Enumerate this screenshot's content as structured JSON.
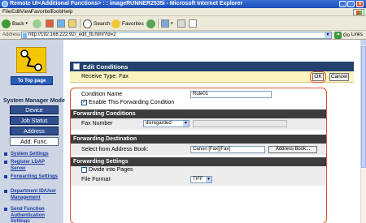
{
  "window": {
    "title": "Remote UI<Additional Functions> : : imageRUNNER2535i - Microsoft Internet Explorer"
  },
  "menu": {
    "items": [
      "File",
      "Edit",
      "View",
      "Favorites",
      "Tools",
      "Help"
    ]
  },
  "toolbar": {
    "back": "Back",
    "search": "Search",
    "favorites": "Favorites"
  },
  "address": {
    "label": "Address",
    "url": "http://192.168.222.92/_edit_fb.html?id=2",
    "go": "Go",
    "links": "Links"
  },
  "sidebar": {
    "top_page": "To Top page",
    "mode_title": "System Manager Mode",
    "nav": [
      "Device",
      "Job Status",
      "Address",
      "Add. Func."
    ],
    "active_nav": "Add. Func.",
    "links": [
      "System Settings",
      "Register LDAP Server",
      "Forwarding Settings",
      "Department ID/User Management",
      "Send Function Authentication Settings"
    ]
  },
  "main": {
    "title": "Edit Conditions",
    "receive_type": "Receive Type: Fax",
    "ok": "OK",
    "cancel": "Cancel",
    "condition_name_label": "Condition Name",
    "condition_name_value": "Rule01",
    "enable_label": "Enable This Forwarding Condition",
    "enable_checked": true,
    "forwarding_conditions": {
      "header": "Forwarding Conditions",
      "fax_number_label": "Fax Number",
      "fax_number_value": "disregarded"
    },
    "forwarding_destination": {
      "header": "Forwarding Destination",
      "select_label": "Select from Address Book:",
      "destination_value": "Canon [Fax][Fax]",
      "address_book_button": "Address Book..."
    },
    "forwarding_settings": {
      "header": "Forwarding Settings",
      "divide_label": "Divide into Pages",
      "divide_checked": false,
      "file_format_label": "File Format",
      "file_format_value": "TIFF"
    }
  },
  "colors": {
    "header": "#24406e",
    "highlight": "#e0532b",
    "receive_bg": "#fbf3bf",
    "sidebar": "#cdd5e4"
  }
}
